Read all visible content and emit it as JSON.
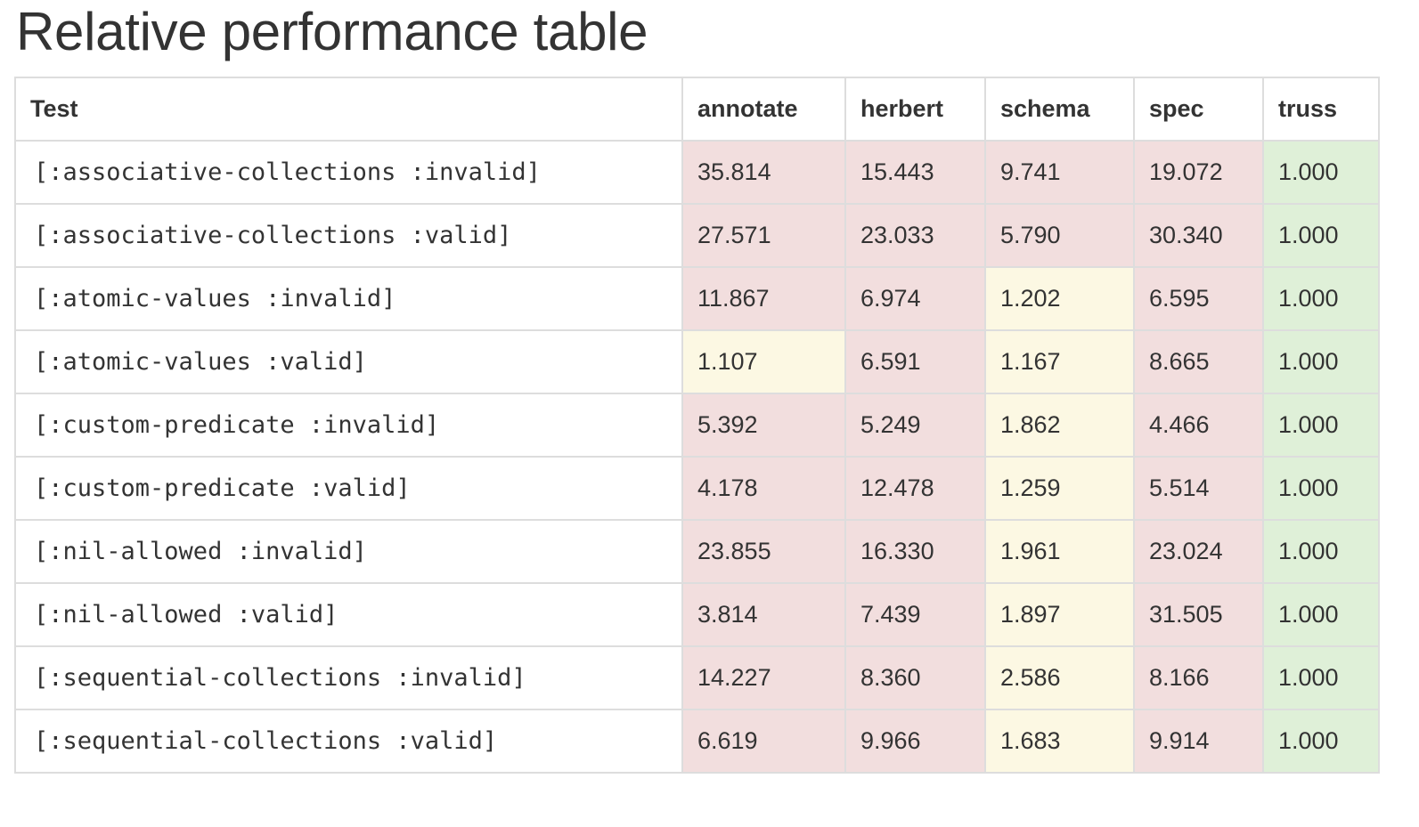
{
  "title": "Relative performance table",
  "colors": {
    "bad": "#f2dede",
    "warn": "#fcf8e3",
    "good": "#dff0d8",
    "border": "#dddddd",
    "text": "#333333"
  },
  "table": {
    "headers": [
      "Test",
      "annotate",
      "herbert",
      "schema",
      "spec",
      "truss"
    ],
    "rows": [
      {
        "test": "[:associative-collections :invalid]",
        "values": [
          "35.814",
          "15.443",
          "9.741",
          "19.072",
          "1.000"
        ],
        "status": [
          "bad",
          "bad",
          "bad",
          "bad",
          "good"
        ]
      },
      {
        "test": "[:associative-collections :valid]",
        "values": [
          "27.571",
          "23.033",
          "5.790",
          "30.340",
          "1.000"
        ],
        "status": [
          "bad",
          "bad",
          "bad",
          "bad",
          "good"
        ]
      },
      {
        "test": "[:atomic-values :invalid]",
        "values": [
          "11.867",
          "6.974",
          "1.202",
          "6.595",
          "1.000"
        ],
        "status": [
          "bad",
          "bad",
          "warn",
          "bad",
          "good"
        ]
      },
      {
        "test": "[:atomic-values :valid]",
        "values": [
          "1.107",
          "6.591",
          "1.167",
          "8.665",
          "1.000"
        ],
        "status": [
          "warn",
          "bad",
          "warn",
          "bad",
          "good"
        ]
      },
      {
        "test": "[:custom-predicate :invalid]",
        "values": [
          "5.392",
          "5.249",
          "1.862",
          "4.466",
          "1.000"
        ],
        "status": [
          "bad",
          "bad",
          "warn",
          "bad",
          "good"
        ]
      },
      {
        "test": "[:custom-predicate :valid]",
        "values": [
          "4.178",
          "12.478",
          "1.259",
          "5.514",
          "1.000"
        ],
        "status": [
          "bad",
          "bad",
          "warn",
          "bad",
          "good"
        ]
      },
      {
        "test": "[:nil-allowed :invalid]",
        "values": [
          "23.855",
          "16.330",
          "1.961",
          "23.024",
          "1.000"
        ],
        "status": [
          "bad",
          "bad",
          "warn",
          "bad",
          "good"
        ]
      },
      {
        "test": "[:nil-allowed :valid]",
        "values": [
          "3.814",
          "7.439",
          "1.897",
          "31.505",
          "1.000"
        ],
        "status": [
          "bad",
          "bad",
          "warn",
          "bad",
          "good"
        ]
      },
      {
        "test": "[:sequential-collections :invalid]",
        "values": [
          "14.227",
          "8.360",
          "2.586",
          "8.166",
          "1.000"
        ],
        "status": [
          "bad",
          "bad",
          "warn",
          "bad",
          "good"
        ]
      },
      {
        "test": "[:sequential-collections :valid]",
        "values": [
          "6.619",
          "9.966",
          "1.683",
          "9.914",
          "1.000"
        ],
        "status": [
          "bad",
          "bad",
          "warn",
          "bad",
          "good"
        ]
      }
    ]
  }
}
